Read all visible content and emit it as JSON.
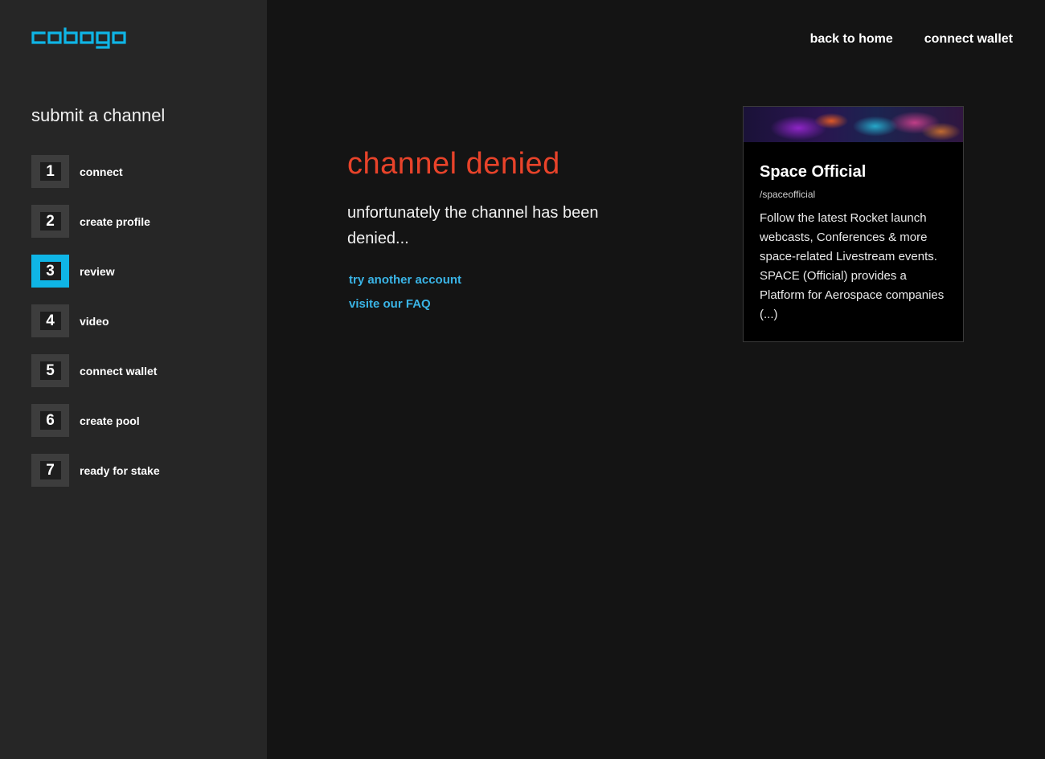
{
  "brand": {
    "logo_text": "cobogo",
    "logo_color": "#0fb5e6"
  },
  "sidebar": {
    "title": "submit a channel",
    "steps": [
      {
        "number": "1",
        "label": "connect"
      },
      {
        "number": "2",
        "label": "create profile"
      },
      {
        "number": "3",
        "label": "review",
        "active": true
      },
      {
        "number": "4",
        "label": "video"
      },
      {
        "number": "5",
        "label": "connect wallet"
      },
      {
        "number": "6",
        "label": "create pool"
      },
      {
        "number": "7",
        "label": "ready for stake"
      }
    ]
  },
  "topnav": {
    "back_label": "back to home",
    "wallet_label": "connect wallet"
  },
  "main": {
    "title": "channel denied",
    "title_color": "#e8432a",
    "message": "unfortunately the channel has been denied...",
    "links": {
      "retry": "try another account",
      "faq": "visite our FAQ"
    },
    "link_color": "#3ab4e6"
  },
  "card": {
    "title": "Space Official",
    "handle": "/spaceofficial",
    "description": "Follow the latest Rocket launch webcasts, Conferences & more space-related Livestream events. SPACE (Official) provides a Platform for Aerospace companies (...)"
  }
}
